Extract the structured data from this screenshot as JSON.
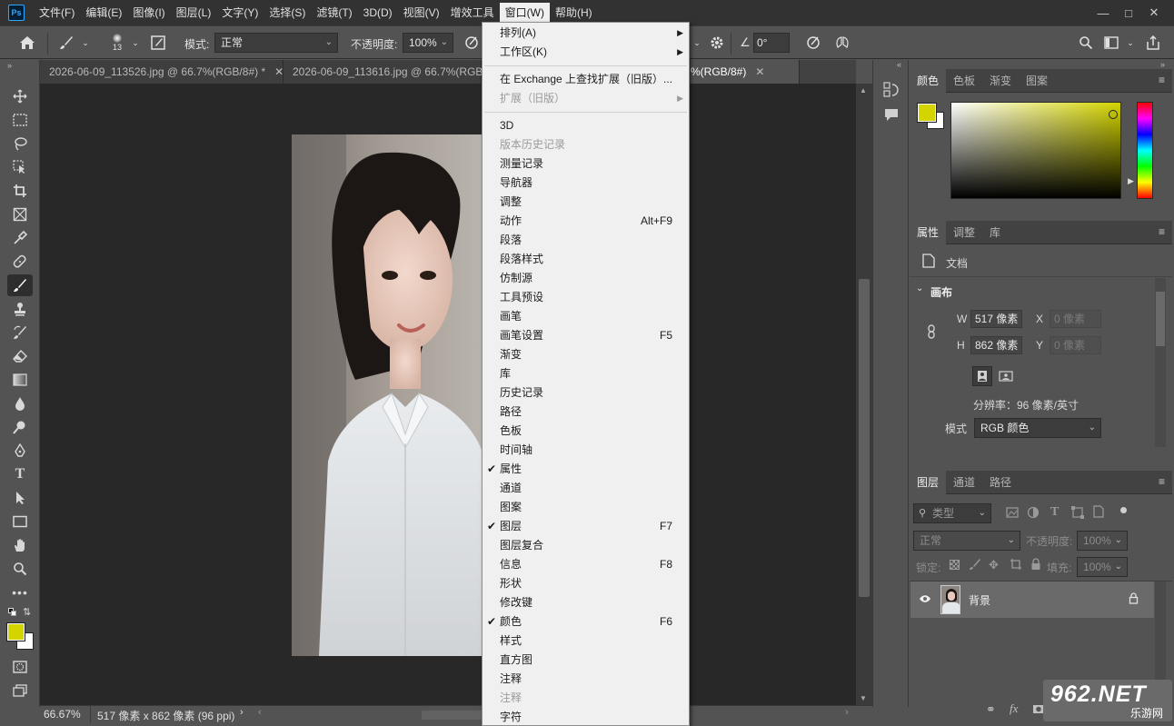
{
  "app": {
    "logo": "Ps"
  },
  "menubar": {
    "items": [
      "文件(F)",
      "编辑(E)",
      "图像(I)",
      "图层(L)",
      "文字(Y)",
      "选择(S)",
      "滤镜(T)",
      "3D(D)",
      "视图(V)",
      "增效工具",
      "窗口(W)",
      "帮助(H)"
    ],
    "active": "窗口(W)"
  },
  "options": {
    "brush_size": "13",
    "mode_label": "模式:",
    "mode_value": "正常",
    "opacity_label": "不透明度:",
    "opacity_value": "100%",
    "angle_value": "0°"
  },
  "tabs": [
    {
      "label": "2026-06-09_113526.jpg @ 66.7%(RGB/8#) *",
      "active": false
    },
    {
      "label": "2026-06-09_113616.jpg @ 66.7%(RGB/8",
      "active": false
    },
    {
      "label": "%(RGB/8#)",
      "active": true
    }
  ],
  "dropdown": {
    "items": [
      {
        "label": "排列(A)",
        "submenu": true
      },
      {
        "label": "工作区(K)",
        "submenu": true
      },
      {
        "sep": true
      },
      {
        "label": "在 Exchange 上查找扩展（旧版）..."
      },
      {
        "label": "扩展（旧版）",
        "submenu": true,
        "disabled": true
      },
      {
        "sep": true
      },
      {
        "label": "3D"
      },
      {
        "label": "版本历史记录",
        "disabled": true
      },
      {
        "label": "测量记录"
      },
      {
        "label": "导航器"
      },
      {
        "label": "调整"
      },
      {
        "label": "动作",
        "shortcut": "Alt+F9"
      },
      {
        "label": "段落"
      },
      {
        "label": "段落样式"
      },
      {
        "label": "仿制源"
      },
      {
        "label": "工具预设"
      },
      {
        "label": "画笔"
      },
      {
        "label": "画笔设置",
        "shortcut": "F5"
      },
      {
        "label": "渐变"
      },
      {
        "label": "库"
      },
      {
        "label": "历史记录"
      },
      {
        "label": "路径"
      },
      {
        "label": "色板"
      },
      {
        "label": "时间轴"
      },
      {
        "label": "属性",
        "checked": true
      },
      {
        "label": "通道"
      },
      {
        "label": "图案"
      },
      {
        "label": "图层",
        "checked": true,
        "shortcut": "F7"
      },
      {
        "label": "图层复合"
      },
      {
        "label": "信息",
        "shortcut": "F8"
      },
      {
        "label": "形状"
      },
      {
        "label": "修改键"
      },
      {
        "label": "颜色",
        "checked": true,
        "shortcut": "F6"
      },
      {
        "label": "样式"
      },
      {
        "label": "直方图"
      },
      {
        "label": "注释"
      },
      {
        "label": "注释",
        "disabled": true
      },
      {
        "label": "字符"
      }
    ]
  },
  "color_panel": {
    "tabs": [
      "颜色",
      "色板",
      "渐变",
      "图案"
    ],
    "foreground": "#d4d400",
    "background": "#ffffff"
  },
  "properties_panel": {
    "tabs": [
      "属性",
      "调整",
      "库"
    ],
    "doc_label": "文档",
    "section": "画布",
    "w_label": "W",
    "w_value": "517 像素",
    "h_label": "H",
    "h_value": "862 像素",
    "x_label": "X",
    "x_placeholder": "0 像素",
    "y_label": "Y",
    "y_placeholder": "0 像素",
    "resolution": "分辨率：96 像素/英寸",
    "mode_label": "模式",
    "mode_value": "RGB 颜色"
  },
  "layers_panel": {
    "tabs": [
      "图层",
      "通道",
      "路径"
    ],
    "filter_placeholder": "类型",
    "blend_mode": "正常",
    "opacity_label": "不透明度:",
    "opacity_value": "100%",
    "lock_label": "锁定:",
    "fill_label": "填充:",
    "fill_value": "100%",
    "layer_name": "背景"
  },
  "status": {
    "zoom": "66.67%",
    "doc_info": "517 像素 x 862 像素 (96 ppi)"
  },
  "watermark": {
    "brand": "962.NET",
    "sub": "乐游网"
  }
}
